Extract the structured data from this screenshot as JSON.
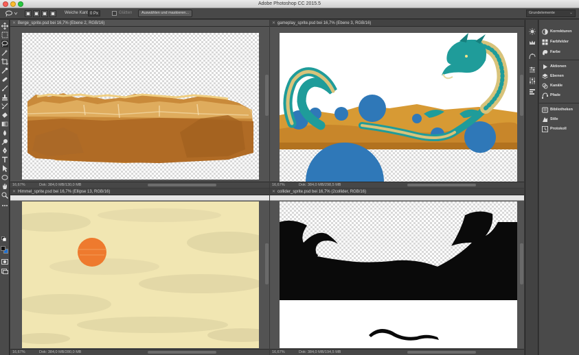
{
  "app": {
    "title": "Adobe Photoshop CC 2015.5"
  },
  "options_bar": {
    "feather_label": "Weiche Kante:",
    "feather_value": "0 Px",
    "antialias_label": "Glätten",
    "select_mask_label": "Auswählen und maskieren...",
    "workspace": "Grundelemente"
  },
  "documents": [
    {
      "title": "Berge_sprite.psd bei 16,7% (Ebene 2, RGB/16)",
      "zoom": "16,67%",
      "info": "Dok: 384,0 MB/130,0 MB"
    },
    {
      "title": "gameplay_sprite.psd bei 16,7% (Ebene 3, RGB/16)",
      "zoom": "16,67%",
      "info": "Dok: 384,0 MB/298,5 MB"
    },
    {
      "title": "Himmel_sprite.psd bei 16,7% (Ellipse 13, RGB/16)",
      "zoom": "16,67%",
      "info": "Dok: 384,0 MB/280,0 MB"
    },
    {
      "title": "collider_sprite.psd bei 16,7% (2collider, RGB/16)",
      "zoom": "16,67%",
      "info": "Dok: 384,0 MB/194,5 MB"
    }
  ],
  "panels": {
    "group1": [
      "Korrekturen",
      "Farbfelder",
      "Farbe"
    ],
    "group2": [
      "Aktionen",
      "Ebenen",
      "Kanäle",
      "Pfade"
    ],
    "group3": [
      "Bibliotheken",
      "Stile",
      "Protokoll"
    ]
  },
  "colors": {
    "sun": "#ee7a2e",
    "water": "#2f78b8",
    "dragon": "#1f9c9a",
    "sky": "#f1e6b2",
    "collider": "#0a0a0a",
    "accent_bg_swatch": "#1e6fd0"
  },
  "icons": {
    "tools": [
      "move-icon",
      "marquee-icon",
      "lasso-icon",
      "magic-wand-icon",
      "crop-icon",
      "eyedropper-icon",
      "healing-brush-icon",
      "brush-icon",
      "stamp-icon",
      "history-brush-icon",
      "eraser-icon",
      "gradient-icon",
      "blur-icon",
      "dodge-icon",
      "pen-icon",
      "type-icon",
      "path-select-icon",
      "ellipse-icon",
      "hand-icon",
      "zoom-icon",
      "more-tools-icon"
    ]
  }
}
